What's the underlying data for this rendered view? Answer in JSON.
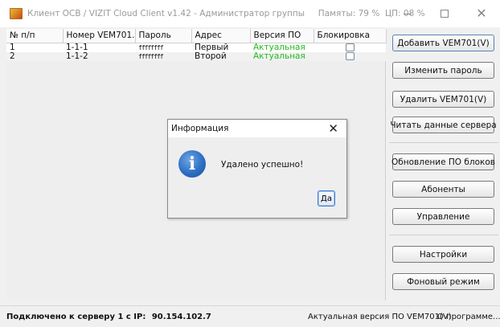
{
  "window": {
    "title": "Клиент ОСВ / VIZIT Cloud Client v1.42 - Администратор группы",
    "memory": "Памяты: 79 %",
    "cpu": "ЦП: 08 %",
    "icons": {
      "minimize": "minimize-icon",
      "maximize": "maximize-icon",
      "close": "close-icon"
    }
  },
  "table": {
    "columns": [
      "№ п/п",
      "Номер VEM701...",
      "Пароль",
      "Адрес",
      "Версия ПО",
      "Блокировка"
    ],
    "rows": [
      {
        "num": "1",
        "vem": "1-1-1",
        "password": "ffffffff",
        "address": "Первый",
        "version": "Актуальная",
        "blocked": false
      },
      {
        "num": "2",
        "vem": "1-1-2",
        "password": "ffffffff",
        "address": "Второй",
        "version": "Актуальная",
        "blocked": false
      }
    ]
  },
  "buttons": {
    "add": "Добавить VEM701(V)",
    "change_password": "Изменить пароль",
    "delete": "Удалить VEM701(V)",
    "read_server": "Читать данные сервера",
    "update_fw": "Обновление ПО блоков",
    "subscribers": "Абоненты",
    "control": "Управление",
    "settings": "Настройки",
    "background": "Фоновый режим"
  },
  "dialog": {
    "title": "Информация",
    "message": "Удалено успешно!",
    "ok": "Да",
    "icon": "info-icon"
  },
  "status": {
    "connected": "Подключено к серверу 1 с IP:",
    "ip": "90.154.102.7",
    "firmware": "Актуальная версия ПО VEM701(V)",
    "about": "О программе..."
  },
  "colors": {
    "version_ok": "#22bb22",
    "dialog_button_border": "#3d7ad6",
    "info_icon": "#2d6fc4"
  }
}
